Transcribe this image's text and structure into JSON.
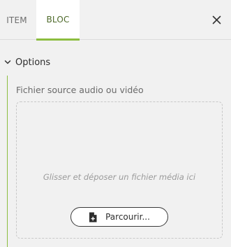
{
  "tabs": {
    "item_label": "ITEM",
    "bloc_label": "BLOC"
  },
  "section": {
    "title": "Options"
  },
  "field": {
    "label": "Fichier source audio ou vidéo",
    "drop_hint": "Glisser et déposer un fichier média ici",
    "browse_label": "Parcourir..."
  },
  "icons": {
    "close": "close-icon",
    "chevron": "chevron-down-icon",
    "file": "file-add-icon"
  },
  "colors": {
    "accent": "#8cbd3f",
    "active_tab_text": "#4e6a2a",
    "background": "#f1f1f1"
  }
}
